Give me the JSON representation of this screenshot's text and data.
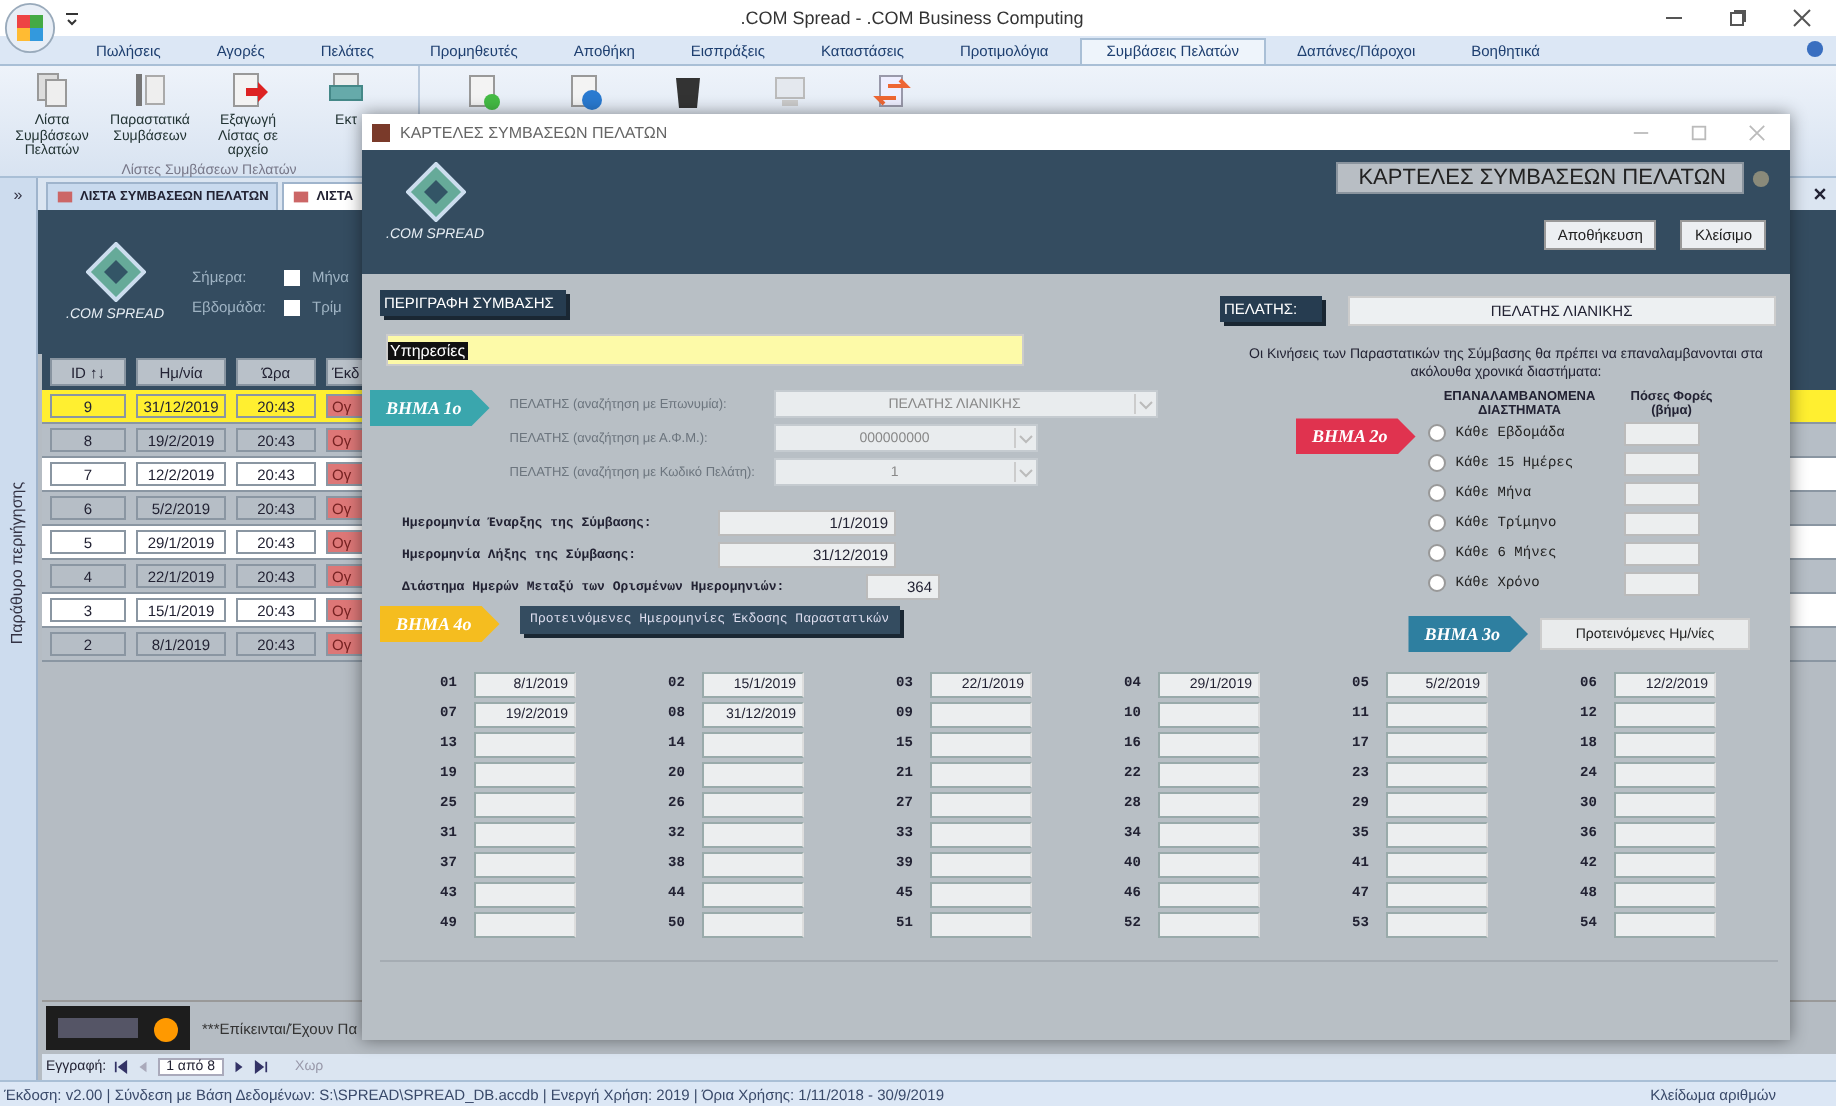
{
  "window": {
    "title": ".COM Spread - .COM Business Computing"
  },
  "ribbon_tabs": [
    {
      "label": "Πωλήσεις",
      "selected": false
    },
    {
      "label": "Αγορές",
      "selected": false
    },
    {
      "label": "Πελάτες",
      "selected": false
    },
    {
      "label": "Προμηθευτές",
      "selected": false
    },
    {
      "label": "Αποθήκη",
      "selected": false
    },
    {
      "label": "Εισπράξεις",
      "selected": false
    },
    {
      "label": "Καταστάσεις",
      "selected": false
    },
    {
      "label": "Προτιμολόγια",
      "selected": false
    },
    {
      "label": "Συμβάσεις Πελατών",
      "selected": true
    },
    {
      "label": "Δαπάνες/Πάροχοι",
      "selected": false
    },
    {
      "label": "Βοηθητικά",
      "selected": false
    }
  ],
  "ribbon_buttons": [
    "Λίστα Συμβάσεων Πελατών",
    "Παραστατικά Συμβάσεων",
    "Εξαγωγή Λίστας σε αρχείο",
    "Εκτ"
  ],
  "ribbon_group": "Λίστες Συμβάσεων Πελατών",
  "nav_pane": {
    "toggle": "»",
    "label": "Παράθυρο περιήγησης"
  },
  "doc_tabs": [
    {
      "label": "ΛΙΣΤΑ ΣΥΜΒΑΣΕΩΝ ΠΕΛΑΤΩΝ",
      "selected": false
    },
    {
      "label": "ΛΙΣΤΑ",
      "selected": true
    }
  ],
  "list_form": {
    "logo": ".COM SPREAD",
    "filters": [
      {
        "label": "Σήμερα:",
        "checked": false,
        "cut_label": "Μήνα"
      },
      {
        "label": "Εβδομάδα:",
        "checked": false,
        "cut_label": "Τρίμ"
      }
    ],
    "columns": [
      "ID ↑↓",
      "Ημ/νία",
      "Ώρα",
      "Έκδ"
    ],
    "rows": [
      {
        "id": "9",
        "date": "31/12/2019",
        "time": "20:43",
        "column_4": "Ογ",
        "selected": true
      },
      {
        "id": "8",
        "date": "19/2/2019",
        "time": "20:43",
        "column_4": "Ογ",
        "selected": false
      },
      {
        "id": "7",
        "date": "12/2/2019",
        "time": "20:43",
        "column_4": "Ογ",
        "selected": false
      },
      {
        "id": "6",
        "date": "5/2/2019",
        "time": "20:43",
        "column_4": "Ογ",
        "selected": false
      },
      {
        "id": "5",
        "date": "29/1/2019",
        "time": "20:43",
        "column_4": "Ογ",
        "selected": false
      },
      {
        "id": "4",
        "date": "22/1/2019",
        "time": "20:43",
        "column_4": "Ογ",
        "selected": false
      },
      {
        "id": "3",
        "date": "15/1/2019",
        "time": "20:43",
        "column_4": "Ογ",
        "selected": false
      },
      {
        "id": "2",
        "date": "8/1/2019",
        "time": "20:43",
        "column_4": "Ογ",
        "selected": false
      }
    ],
    "notice": "***Επίκεινται/Έχουν Πα",
    "record_nav": {
      "label": "Εγγραφή:",
      "position": "1 από 8",
      "filter": "Χωρ"
    }
  },
  "status_bar": {
    "text": "Έκδοση: v2.00  |  Σύνδεση με Βάση Δεδομένων: S:\\SPREAD\\SPREAD_DB.accdb   |   Ενεργή Χρήση: 2019   |   Όρια Χρήσης: 1/11/2018 - 30/9/2019",
    "num_lock": "Κλείδωμα αριθμών"
  },
  "dialog": {
    "title": "ΚΑΡΤΕΛΕΣ ΣΥΜΒΑΣΕΩΝ ΠΕΛΑΤΩΝ",
    "logo": ".COM SPREAD",
    "heading": "ΚΑΡΤΕΛΕΣ ΣΥΜΒΑΣΕΩΝ ΠΕΛΑΤΩΝ",
    "buttons": [
      "Αποθήκευση",
      "Κλείσιμο"
    ],
    "description_label": "ΠΕΡΙΓΡΑΦΗ ΣΥΜΒΑΣΗΣ",
    "description": "Υπηρεσίες",
    "client_label": "ΠΕΛΑΤΗΣ:",
    "client": "ΠΕΛΑΤΗΣ ΛΙΑΝΙΚΗΣ",
    "steps": [
      {
        "label": "ΒΗΜΑ 1ο",
        "color": "#3aa6ad"
      },
      {
        "label": "ΒΗΜΑ 2ο",
        "color": "#e0334f"
      },
      {
        "label": "ΒΗΜΑ 3ο",
        "color": "#2e7fa0"
      },
      {
        "label": "ΒΗΜΑ 4ο",
        "color": "#f5bd1f"
      }
    ],
    "client_lookups": [
      {
        "label": "ΠΕΛΑΤΗΣ (αναζήτηση με Επωνυμία):",
        "value": "ΠΕΛΑΤΗΣ ΛΙΑΝΙΚΗΣ",
        "disabled": true
      },
      {
        "label": "ΠΕΛΑΤΗΣ (αναζήτηση με Α.Φ.Μ.):",
        "value": "000000000",
        "disabled": true
      },
      {
        "label": "ΠΕΛΑΤΗΣ (αναζήτηση με Κωδικό Πελάτη):",
        "value": "1",
        "disabled": true
      }
    ],
    "period": [
      {
        "label": "Ημερομηνία Έναρξης της Σύμβασης:",
        "value": "1/1/2019"
      },
      {
        "label": "Ημερομηνία Λήξης της Σύμβασης:",
        "value": "31/12/2019"
      },
      {
        "label": "Διάστημα Ημερών Μεταξύ των Ορισμένων Ημερομηνιών:",
        "value": "364"
      }
    ],
    "intervals_note": "Οι Κινήσεις των Παραστατικών της Σύμβασης θα πρέπει να επαναλαμβανονται στα ακόλουθα χρονικά διαστήματα:",
    "intervals_header": "ΕΠΑΝΑΛΑΜΒΑΝΟΜΕΝΑ ΔΙΑΣΤΗΜΑΤΑ",
    "count_header": "Πόσες Φορές (βήμα)",
    "intervals": [
      {
        "label": "Κάθε Εβδομάδα",
        "selected": false
      },
      {
        "label": "Κάθε 15 Ημέρες",
        "selected": false
      },
      {
        "label": "Κάθε Μήνα",
        "selected": false
      },
      {
        "label": "Κάθε Τρίμηνο",
        "selected": false
      },
      {
        "label": "Κάθε 6 Μήνες",
        "selected": false
      },
      {
        "label": "Κάθε Χρόνο",
        "selected": false
      }
    ],
    "suggest_button": "Προτεινόμενες Ημ/νίες",
    "dates_title": "Προτεινόμενες Ημερομηνίες Έκδοσης Παραστατικών",
    "dates": [
      {
        "n": "01",
        "value": "8/1/2019"
      },
      {
        "n": "02",
        "value": "15/1/2019"
      },
      {
        "n": "03",
        "value": "22/1/2019"
      },
      {
        "n": "04",
        "value": "29/1/2019"
      },
      {
        "n": "05",
        "value": "5/2/2019"
      },
      {
        "n": "06",
        "value": "12/2/2019"
      },
      {
        "n": "07",
        "value": "19/2/2019"
      },
      {
        "n": "08",
        "value": "31/12/2019"
      },
      {
        "n": "09"
      },
      {
        "n": "10"
      },
      {
        "n": "11"
      },
      {
        "n": "12"
      },
      {
        "n": "13"
      },
      {
        "n": "14"
      },
      {
        "n": "15"
      },
      {
        "n": "16"
      },
      {
        "n": "17"
      },
      {
        "n": "18"
      },
      {
        "n": "19"
      },
      {
        "n": "20"
      },
      {
        "n": "21"
      },
      {
        "n": "22"
      },
      {
        "n": "23"
      },
      {
        "n": "24"
      },
      {
        "n": "25"
      },
      {
        "n": "26"
      },
      {
        "n": "27"
      },
      {
        "n": "28"
      },
      {
        "n": "29"
      },
      {
        "n": "30"
      },
      {
        "n": "31"
      },
      {
        "n": "32"
      },
      {
        "n": "33"
      },
      {
        "n": "34"
      },
      {
        "n": "35"
      },
      {
        "n": "36"
      },
      {
        "n": "37"
      },
      {
        "n": "38"
      },
      {
        "n": "39"
      },
      {
        "n": "40"
      },
      {
        "n": "41"
      },
      {
        "n": "42"
      },
      {
        "n": "43"
      },
      {
        "n": "44"
      },
      {
        "n": "45"
      },
      {
        "n": "46"
      },
      {
        "n": "47"
      },
      {
        "n": "48"
      },
      {
        "n": "49"
      },
      {
        "n": "50"
      },
      {
        "n": "51"
      },
      {
        "n": "52"
      },
      {
        "n": "53"
      },
      {
        "n": "54"
      }
    ]
  }
}
